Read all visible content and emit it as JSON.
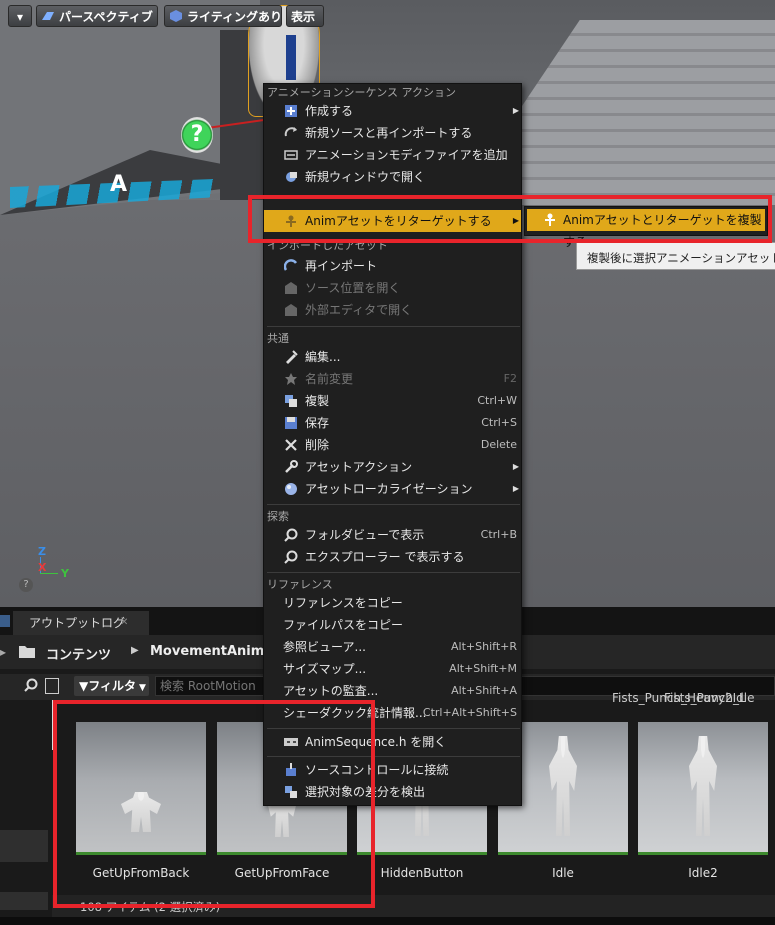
{
  "toolbar": {
    "perspective_label": "パースペクティブ",
    "lighting_label": "ライティングあり",
    "show_label": "表示"
  },
  "viewport": {
    "axis_z": "Z",
    "axis_x": "X",
    "axis_y": "Y",
    "help_icon": "?"
  },
  "menu": {
    "section_anim": "アニメーションシーケンス アクション",
    "items_anim": [
      {
        "label": "作成する",
        "icon": "create-icon",
        "submenu": true
      },
      {
        "label": "新規ソースと再インポートする",
        "icon": "reimport-source-icon"
      },
      {
        "label": "アニメーションモディファイアを追加",
        "icon": "modifier-icon"
      },
      {
        "label": "新規ウィンドウで開く",
        "icon": "new-window-icon"
      },
      {
        "label": "Animアセットをリターゲットする",
        "icon": "retarget-icon",
        "submenu": true,
        "highlighted": true
      }
    ],
    "section_import": "インポートしたアセット",
    "items_import": [
      {
        "label": "再インポート",
        "icon": "reimport-icon"
      },
      {
        "label": "ソース位置を開く",
        "icon": "source-location-icon",
        "disabled": true
      },
      {
        "label": "外部エディタで開く",
        "icon": "external-editor-icon",
        "disabled": true
      }
    ],
    "section_common": "共通",
    "items_common": [
      {
        "label": "編集...",
        "icon": "edit-icon"
      },
      {
        "label": "名前変更",
        "icon": "rename-icon",
        "shortcut": "F2",
        "disabled": true
      },
      {
        "label": "複製",
        "icon": "duplicate-icon",
        "shortcut": "Ctrl+W"
      },
      {
        "label": "保存",
        "icon": "save-icon",
        "shortcut": "Ctrl+S"
      },
      {
        "label": "削除",
        "icon": "delete-icon",
        "shortcut": "Delete"
      },
      {
        "label": "アセットアクション",
        "icon": "asset-actions-icon",
        "submenu": true
      },
      {
        "label": "アセットローカライゼーション",
        "icon": "localization-icon",
        "submenu": true
      }
    ],
    "section_explore": "探索",
    "items_explore": [
      {
        "label": "フォルダビューで表示",
        "icon": "folder-view-icon",
        "shortcut": "Ctrl+B"
      },
      {
        "label": "エクスプローラー で表示する",
        "icon": "explorer-icon"
      }
    ],
    "section_ref": "リファレンス",
    "items_ref": [
      {
        "label": "リファレンスをコピー"
      },
      {
        "label": "ファイルパスをコピー"
      },
      {
        "label": "参照ビューア...",
        "shortcut": "Alt+Shift+R"
      },
      {
        "label": "サイズマップ...",
        "shortcut": "Alt+Shift+M"
      },
      {
        "label": "アセットの監査...",
        "shortcut": "Alt+Shift+A"
      },
      {
        "label": "シェーダクック統計情報...",
        "shortcut": "Ctrl+Alt+Shift+S"
      }
    ],
    "items_source": [
      {
        "label": "AnimSequence.h を開く",
        "icon": "cpp-icon"
      }
    ],
    "items_vc": [
      {
        "label": "ソースコントロールに接続",
        "icon": "source-control-icon"
      },
      {
        "label": "選択対象の差分を検出",
        "icon": "diff-icon"
      }
    ]
  },
  "submenu": {
    "label": "Animアセットとリターゲットを複製する",
    "tooltip": "複製後に選択アニメーションアセットを新"
  },
  "output_tab": {
    "label": "アウトプットログ",
    "close": "✕"
  },
  "content_browser": {
    "path_root": "コンテンツ",
    "path_folder": "MovementAnims",
    "filter_label": "フィルタ",
    "search_placeholder": "検索 RootMotion",
    "partial_top_labels": [
      "Fists_Punch_Heavy2Idle",
      "Fists_Punch_L"
    ],
    "assets": [
      {
        "label": "GetUpFromBack",
        "selected": true
      },
      {
        "label": "GetUpFromFace",
        "selected": true
      },
      {
        "label": "HiddenButton",
        "selected": false
      },
      {
        "label": "Idle",
        "selected": false
      },
      {
        "label": "Idle2",
        "selected": false
      }
    ],
    "status": "108 アイテム (2 選択済み)"
  },
  "colors": {
    "highlight": "#e0a81a",
    "annotation_red": "#e8242b",
    "menu_bg": "#1f1f1f"
  }
}
